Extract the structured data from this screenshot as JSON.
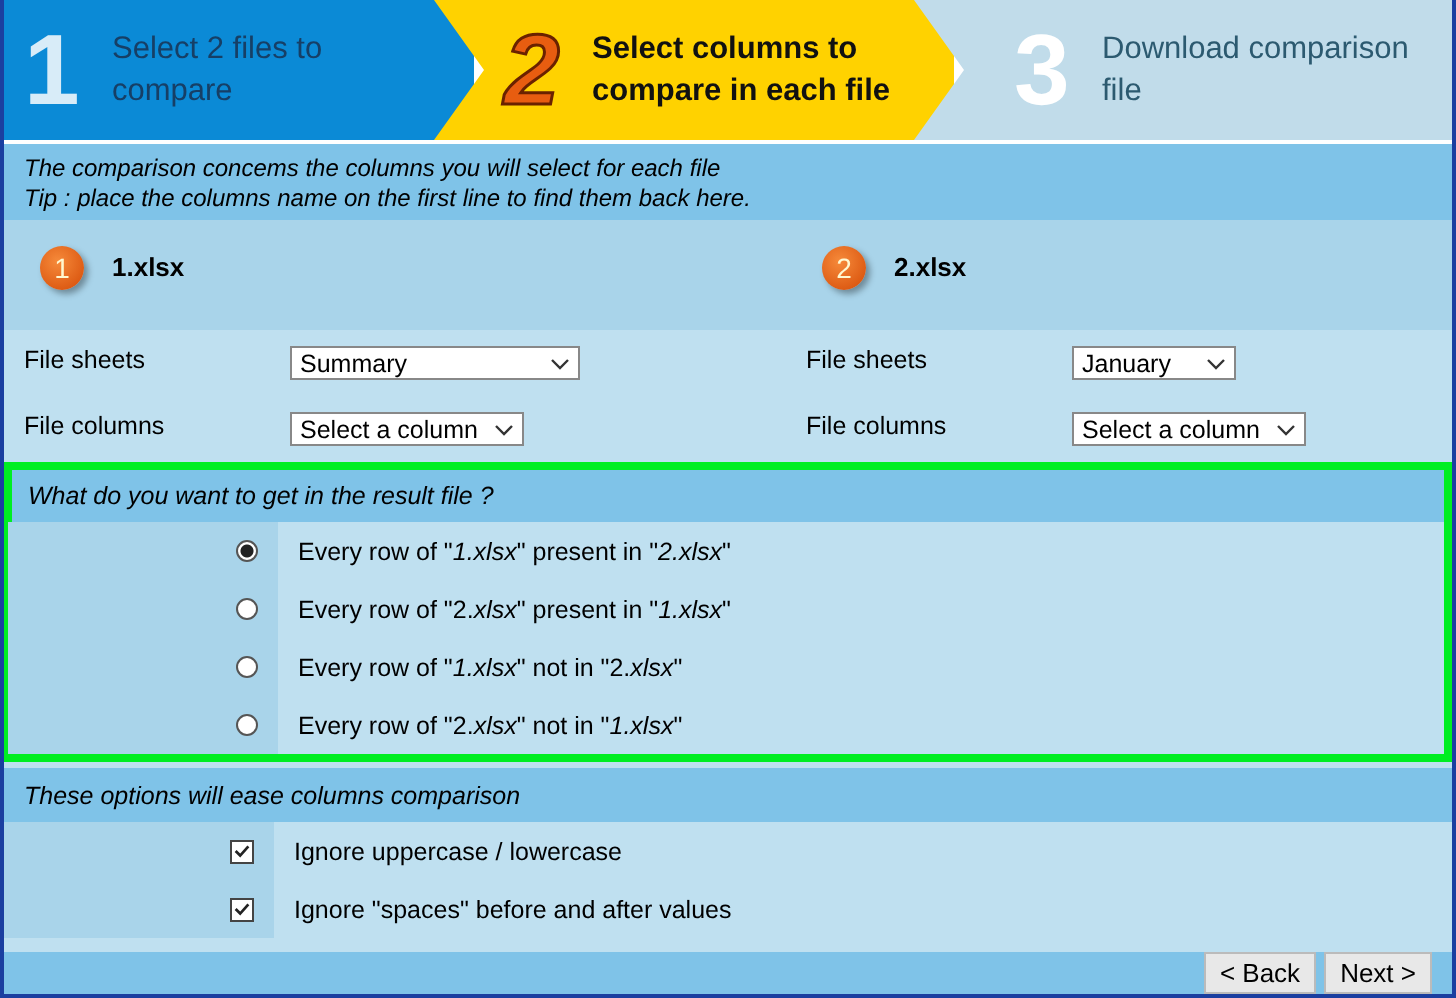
{
  "steps": [
    {
      "number": "1",
      "label": "Select 2 files to compare",
      "kind": "previous"
    },
    {
      "number": "2",
      "label": "Select columns to compare in each file",
      "kind": "current"
    },
    {
      "number": "3",
      "label": "Download comparison file",
      "kind": "next"
    }
  ],
  "intro": [
    "The comparison concems the columns you will select for each file",
    "Tip : place the columns name on the first line to find them back here."
  ],
  "files": [
    {
      "badge": "1",
      "name": "1.xlsx",
      "sheets_label": "File sheets",
      "sheet": "Summary",
      "columns_label": "File columns",
      "column": "Select a column"
    },
    {
      "badge": "2",
      "name": "2.xlsx",
      "sheets_label": "File sheets",
      "sheet": "January",
      "columns_label": "File columns",
      "column": "Select a column"
    }
  ],
  "result": {
    "question": "What do you want to get in the result file ?",
    "options": [
      {
        "label": "Every row of \"*1.xlsx*\" present in \"*2.xlsx*\"",
        "selected": true
      },
      {
        "label": "Every row of \"2.*xlsx*\" present in \"*1.xlsx*\"",
        "selected": false
      },
      {
        "label": "Every row of \"*1.xlsx*\" not in \"2.*xlsx*\"",
        "selected": false
      },
      {
        "label": "Every row of \"2.*xlsx*\" not in \"*1.xlsx*\"",
        "selected": false
      }
    ]
  },
  "comparison": {
    "heading": "These options will ease columns comparison",
    "items": [
      {
        "label": "Ignore uppercase / lowercase",
        "checked": true
      },
      {
        "label": "Ignore \"spaces\" before and after values",
        "checked": true
      }
    ]
  },
  "buttons": [
    "< Back",
    "Next >"
  ]
}
